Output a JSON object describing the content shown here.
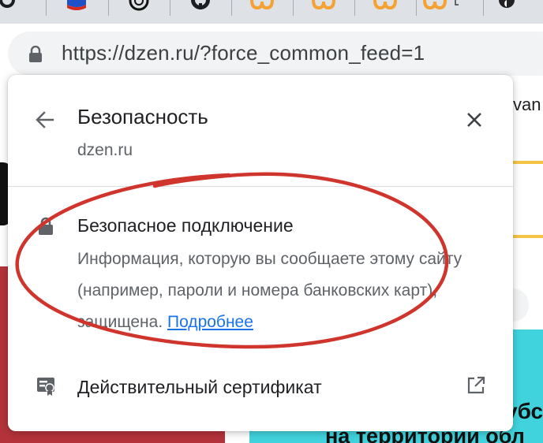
{
  "browser": {
    "url": "https://dzen.ru/?force_common_feed=1",
    "tabs": [
      {
        "icon": "github-icon"
      },
      {
        "icon": "flag-icon"
      },
      {
        "icon": "openai-icon"
      },
      {
        "icon": "github-icon"
      },
      {
        "icon": "loop-icon"
      },
      {
        "icon": "loop-icon"
      },
      {
        "icon": "loop-icon"
      },
      {
        "icon": "loop-icon"
      },
      {
        "icon": "dark-circle-icon"
      }
    ]
  },
  "background": {
    "partial_text_right": "van",
    "partial_text_bottom_right_1": "убс",
    "partial_text_bottom_right_2": "на территории обл"
  },
  "popup": {
    "title": "Безопасность",
    "domain": "dzen.ru",
    "connection": {
      "title": "Безопасное подключение",
      "description": "Информация, которую вы сообщаете этому сайту (например, пароли и номера банковских карт), защищена.",
      "link": "Подробнее"
    },
    "certificate": {
      "label": "Действительный сертификат"
    }
  },
  "colors": {
    "link": "#1a73e8",
    "annotation": "#d0352d",
    "omnibox_bg": "#f1f3f4"
  }
}
